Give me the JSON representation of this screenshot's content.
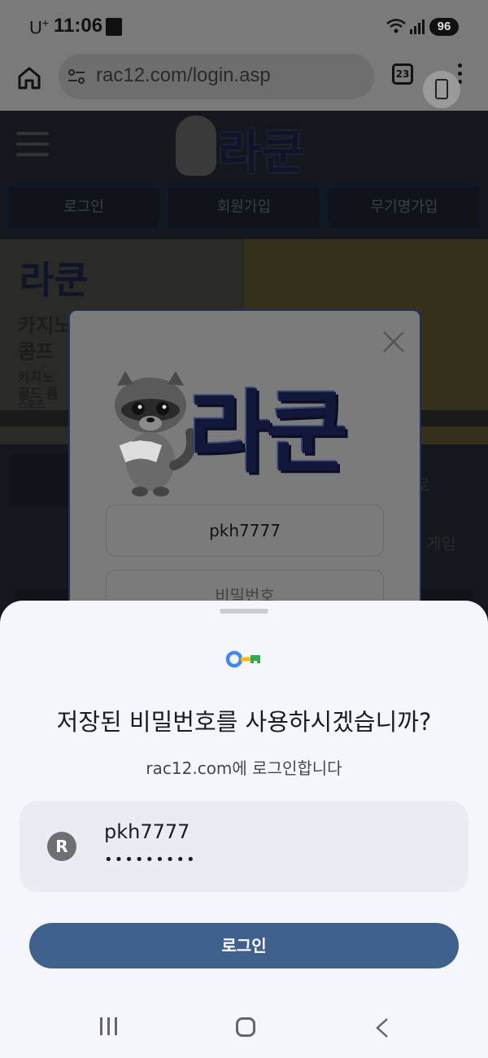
{
  "status_bar": {
    "carrier": "U",
    "carrier_sup": "+",
    "time": "11:06",
    "battery": "96"
  },
  "browser": {
    "url": "rac12.com/login.asp",
    "tab_count": "23"
  },
  "site": {
    "logo_text": "라쿤",
    "nav": [
      "로그인",
      "회원가입",
      "무기명가입"
    ],
    "banner_logo": "라쿤",
    "banner_lines": [
      "카지노",
      "콤프",
      "카지노",
      "골드 콤",
      "스포츠"
    ],
    "category_right_1": "로",
    "category_right_2": "게임"
  },
  "modal": {
    "brand": "라쿤",
    "username_value": "pkh7777",
    "password_placeholder": "비밀번호"
  },
  "sheet": {
    "title": "저장된 비밀번호를 사용하시겠습니까?",
    "subtitle": "rac12.com에 로그인합니다",
    "avatar_letter": "R",
    "username": "pkh7777",
    "password_mask": "•••••••••",
    "login_button": "로그인"
  }
}
